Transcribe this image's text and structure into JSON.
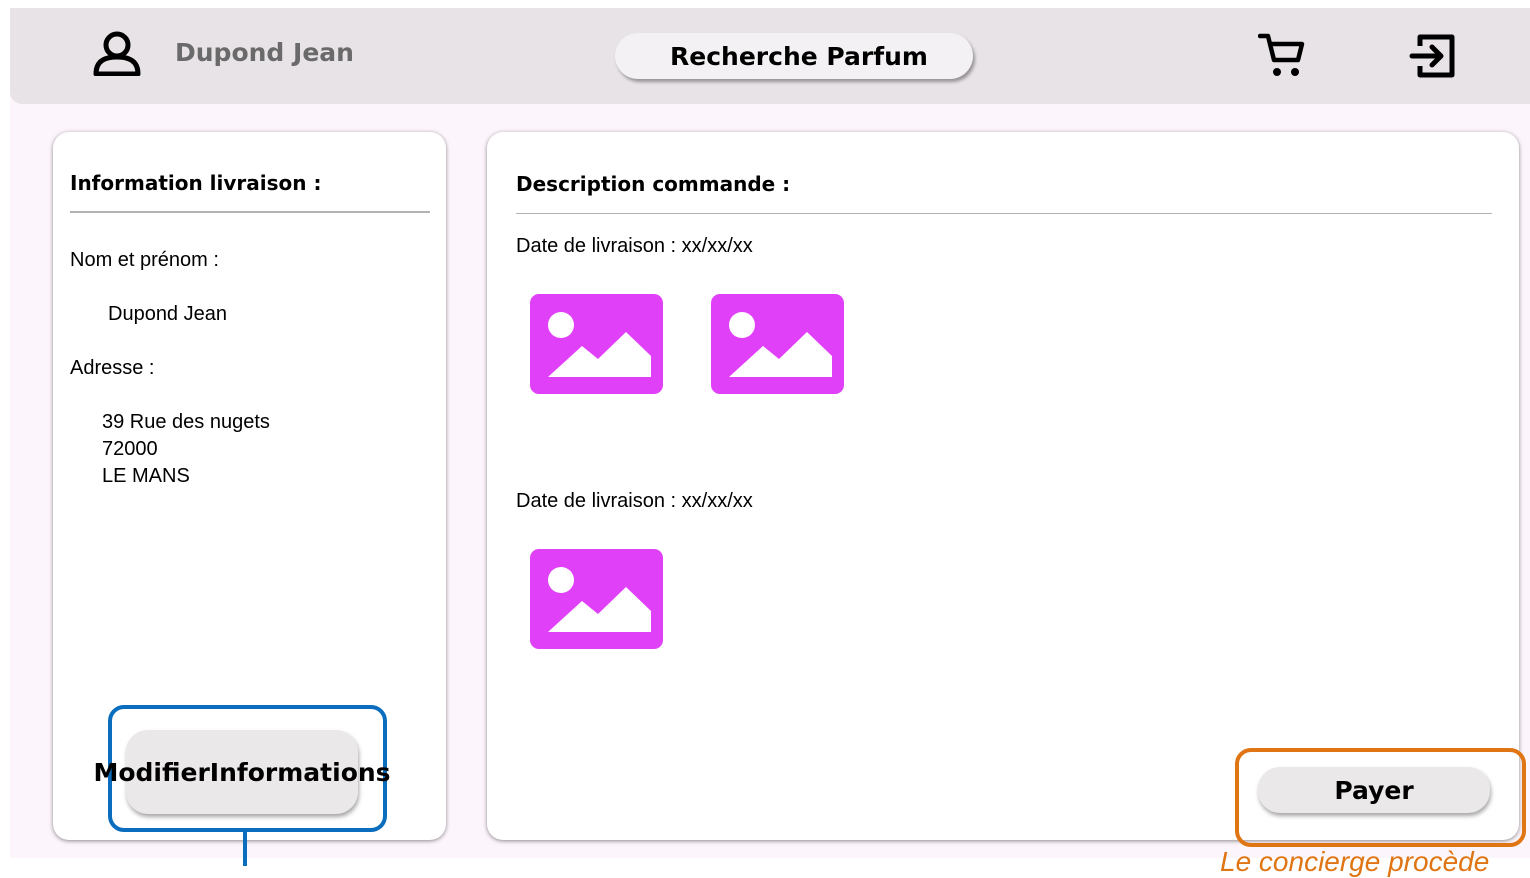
{
  "header": {
    "user_icon": "user-icon",
    "user_name": "Dupond Jean",
    "search_label": "Recherche Parfum",
    "cart_icon": "cart-icon",
    "logout_icon": "logout-icon"
  },
  "delivery_info": {
    "title": "Information livraison :",
    "name_label": "Nom et prénom :",
    "name_value": "Dupond Jean",
    "address_label": "Adresse :",
    "address_lines": [
      "39 Rue des nugets",
      "72000",
      "LE MANS"
    ],
    "modify_button_label": "Modifier\nInformations"
  },
  "order": {
    "title": "Description commande :",
    "deliveries": [
      {
        "date_label": "Date de livraison : xx/xx/xx",
        "product_images": [
          "image-placeholder-icon",
          "image-placeholder-icon"
        ]
      },
      {
        "date_label": "Date de livraison : xx/xx/xx",
        "product_images": [
          "image-placeholder-icon"
        ]
      }
    ],
    "pay_button_label": "Payer"
  },
  "annotations": {
    "orange_note": "Le concierge procède"
  },
  "colors": {
    "header_bg": "#e8e3e7",
    "page_bg": "#fdf5fc",
    "image_placeholder": "#e040f7",
    "annotation_blue": "#0a6dbe",
    "annotation_orange": "#e07514"
  }
}
